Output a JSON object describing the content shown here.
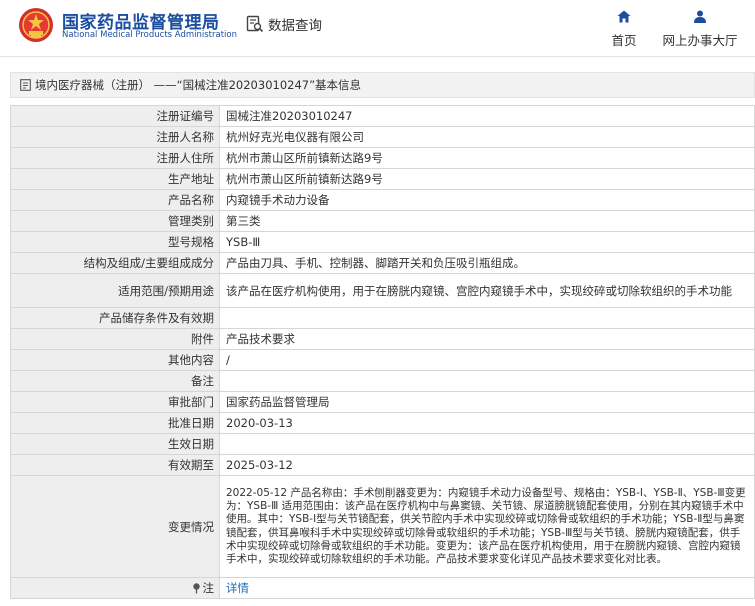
{
  "header": {
    "org_cn": "国家药品监督管理局",
    "org_en": "National Medical Products Administration",
    "query_label": "数据查询",
    "nav": [
      {
        "label": "首页",
        "icon": "home-icon"
      },
      {
        "label": "网上办事大厅",
        "icon": "user-icon"
      }
    ]
  },
  "breadcrumb": {
    "text": "境内医疗器械（注册） ——“国械注准20203010247”基本信息"
  },
  "colors": {
    "brand_blue": "#1c4ea0",
    "link_blue": "#1c6db5",
    "label_bg": "#eeeeee"
  },
  "rows": [
    {
      "label": "注册证编号",
      "value": "国械注准20203010247"
    },
    {
      "label": "注册人名称",
      "value": "杭州好克光电仪器有限公司"
    },
    {
      "label": "注册人住所",
      "value": "杭州市萧山区所前镇新达路9号"
    },
    {
      "label": "生产地址",
      "value": "杭州市萧山区所前镇新达路9号"
    },
    {
      "label": "产品名称",
      "value": "内窥镜手术动力设备"
    },
    {
      "label": "管理类别",
      "value": "第三类"
    },
    {
      "label": "型号规格",
      "value": "YSB-Ⅲ"
    },
    {
      "label": "结构及组成/主要组成成分",
      "value": "产品由刀具、手机、控制器、脚踏开关和负压吸引瓶组成。"
    },
    {
      "label": "适用范围/预期用途",
      "value": "该产品在医疗机构使用，用于在膀胱内窥镜、宫腔内窥镜手术中，实现绞碎或切除软组织的手术功能"
    },
    {
      "label": "产品储存条件及有效期",
      "value": ""
    },
    {
      "label": "附件",
      "value": "产品技术要求"
    },
    {
      "label": "其他内容",
      "value": "/"
    },
    {
      "label": "备注",
      "value": ""
    },
    {
      "label": "审批部门",
      "value": "国家药品监督管理局"
    },
    {
      "label": "批准日期",
      "value": "2020-03-13"
    },
    {
      "label": "生效日期",
      "value": ""
    },
    {
      "label": "有效期至",
      "value": "2025-03-12"
    },
    {
      "label": "变更情况",
      "value": "2022-05-12 产品名称由：手术刨削器变更为：内窥镜手术动力设备型号、规格由：YSB-Ⅰ、YSB-Ⅱ、YSB-Ⅲ变更为：YSB-Ⅲ 适用范围由：该产品在医疗机构中与鼻窦镜、关节镜、尿道膀胱镜配套使用，分别在其内窥镜手术中使用。其中：YSB-Ⅰ型与关节镜配套，供关节腔内手术中实现绞碎或切除骨或软组织的手术功能；YSB-Ⅱ型与鼻窦镜配套，供耳鼻喉科手术中实现绞碎或切除骨或软组织的手术功能；YSB-Ⅲ型与关节镜、膀胱内窥镜配套，供手术中实现绞碎或切除骨或软组织的手术功能。变更为：该产品在医疗机构使用，用于在膀胱内窥镜、宫腔内窥镜手术中，实现绞碎或切除软组织的手术功能。产品技术要求变化详见产品技术要求变化对比表。"
    },
    {
      "label": "注",
      "value": "详情"
    }
  ]
}
